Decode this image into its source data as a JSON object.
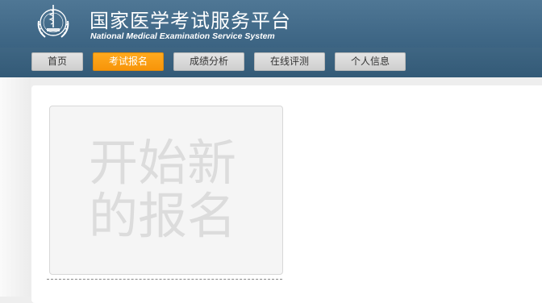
{
  "header": {
    "logo_icon": "medical-emblem-icon",
    "title_cn": "国家医学考试服务平台",
    "title_en": "National Medical Examination Service System"
  },
  "nav": {
    "items": [
      {
        "label": "首页",
        "active": false
      },
      {
        "label": "考试报名",
        "active": true
      },
      {
        "label": "成绩分析",
        "active": false
      },
      {
        "label": "在线评测",
        "active": false
      },
      {
        "label": "个人信息",
        "active": false
      }
    ],
    "active_color": "#f9a01b"
  },
  "main": {
    "new_registration_card": {
      "line1": "开始新",
      "line2": "的报名"
    }
  },
  "colors": {
    "header_bg": "#4a7290",
    "nav_bg": "#3a6180",
    "card_text": "#dcdcdc"
  }
}
